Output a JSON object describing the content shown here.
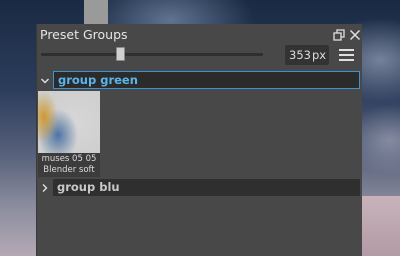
{
  "window": {
    "title": "Preset Groups"
  },
  "toolbar": {
    "size_value": "353",
    "size_unit": "px",
    "size_slider_fraction": 0.36
  },
  "groups": [
    {
      "name": "group green",
      "expanded": true,
      "editing": true,
      "presets": [
        {
          "line1": "muses 05 05",
          "line2": "Blender soft"
        }
      ]
    },
    {
      "name": "group blu",
      "expanded": false
    }
  ],
  "icons": {
    "float": "float-window-icon",
    "close": "close-icon",
    "menu": "hamburger-menu-icon",
    "expanded": "chevron-down-icon",
    "collapsed": "chevron-right-icon"
  },
  "colors": {
    "panel_bg": "#484848",
    "accent": "#3a94cf",
    "accent_text": "#5cb5ea"
  }
}
